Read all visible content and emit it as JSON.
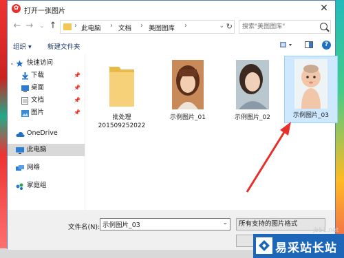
{
  "window": {
    "title": "打开一张图片",
    "close": "✕"
  },
  "address": {
    "crumbs": [
      "此电脑",
      "文档",
      "美图图库"
    ]
  },
  "search": {
    "placeholder": "搜索\"美图图库\""
  },
  "toolbar": {
    "organize": "组织 ▾",
    "new_folder": "新建文件夹",
    "help": "?"
  },
  "nav": {
    "quick_access": "快速访问",
    "items": [
      {
        "label": "下载",
        "icon": "download-icon"
      },
      {
        "label": "桌面",
        "icon": "desktop-icon"
      },
      {
        "label": "文档",
        "icon": "documents-icon"
      },
      {
        "label": "图片",
        "icon": "pictures-icon"
      }
    ],
    "onedrive": "OneDrive",
    "this_pc": "此电脑",
    "network": "网络",
    "homegroup": "家庭组"
  },
  "files": [
    {
      "name": "批处理\n201509252022",
      "type": "folder"
    },
    {
      "name": "示例图片_01",
      "type": "image"
    },
    {
      "name": "示例图片_02",
      "type": "image"
    },
    {
      "name": "示例图片_03",
      "type": "image",
      "selected": true
    }
  ],
  "bottom": {
    "filename_label": "文件名(N):",
    "filename_value": "示例图片_03",
    "filter": "所有支持的图片格式"
  },
  "watermark": {
    "text": "易采站长站",
    "small": "jb51.net"
  },
  "colors": {
    "selection": "#cde8ff",
    "accent": "#1f6fc5",
    "arrow": "#e8302a"
  }
}
